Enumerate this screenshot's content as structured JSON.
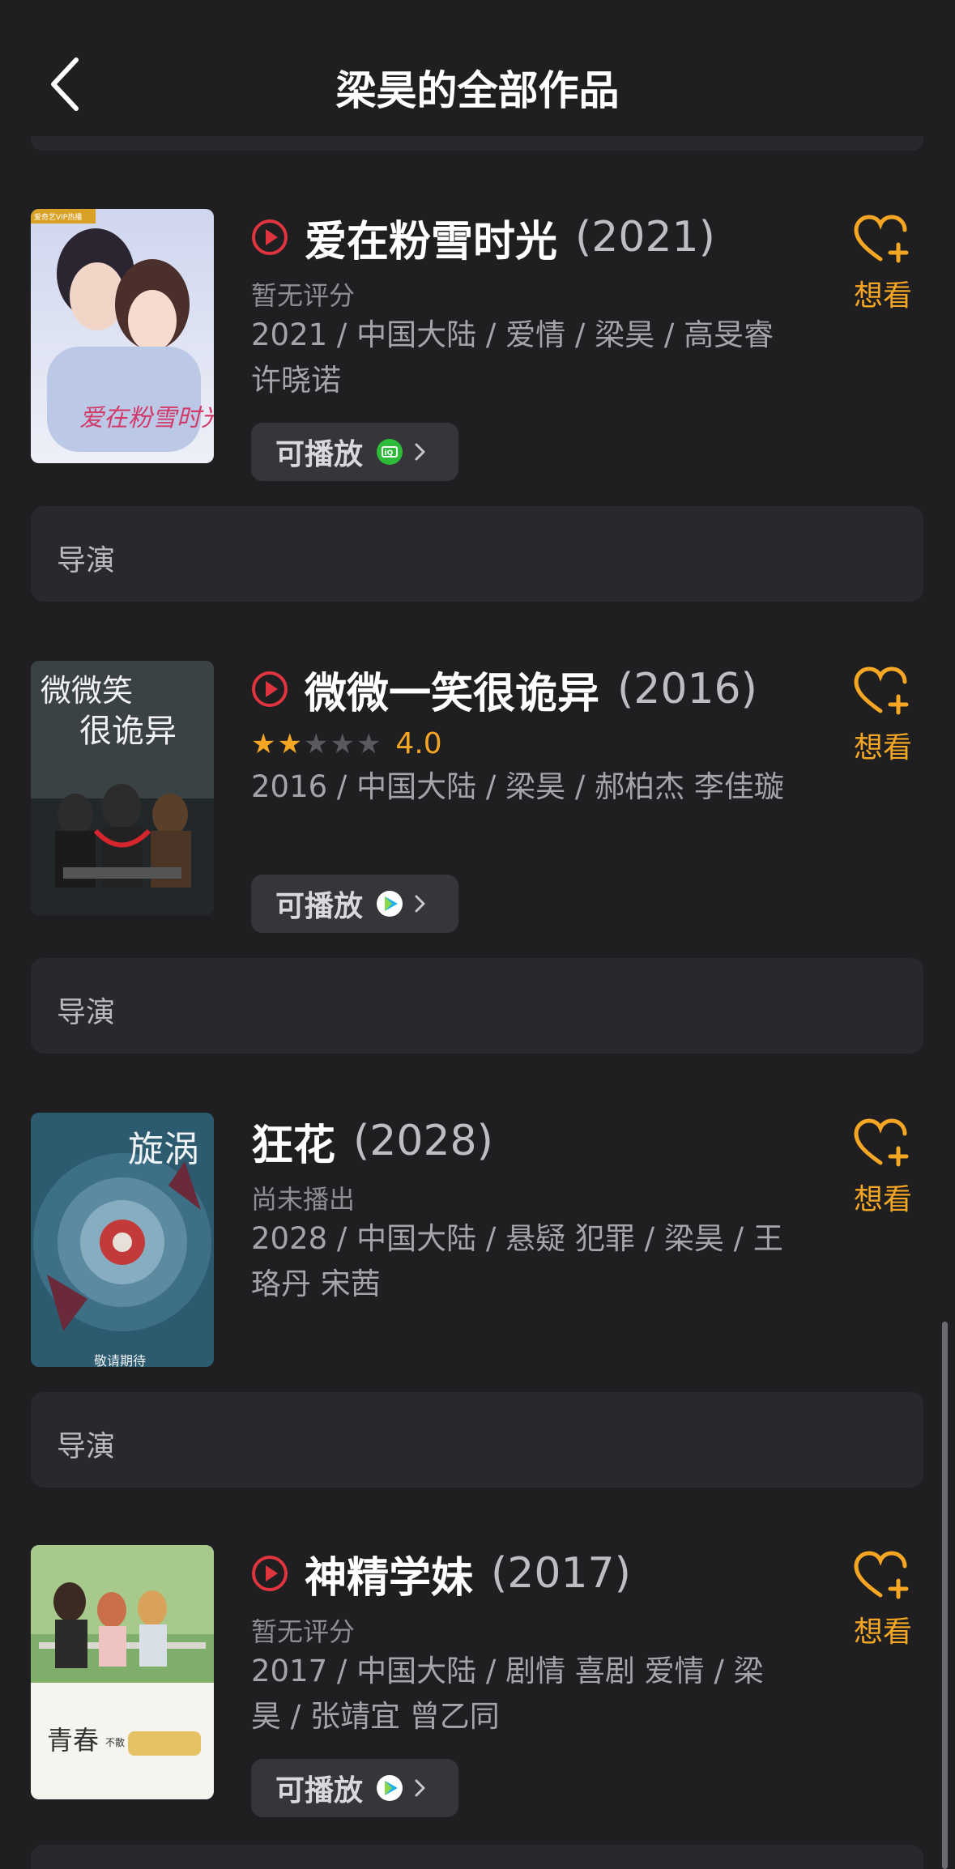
{
  "header": {
    "title": "梁昊的全部作品"
  },
  "colors": {
    "accent": "#f5a623",
    "play_red": "#e0343f",
    "background": "#1f1f22"
  },
  "movies": [
    {
      "title": "爱在粉雪时光",
      "year": "(2021)",
      "rating_text": "暂无评分",
      "meta": "2021 / 中国大陆 / 爱情 / 梁昊 / 高旻睿 许晓诺",
      "play_label": "可播放",
      "platform_icon": "iqiyi-icon",
      "want_label": "想看",
      "poster": {
        "badge": "爱奇艺VIP热播",
        "title": "爱在粉雪时光"
      }
    },
    {
      "title": "微微一笑很诡异",
      "year": "(2016)",
      "rating_score": "4.0",
      "stars_filled": 2,
      "stars_total": 5,
      "meta": "2016 / 中国大陆 / 梁昊 / 郝柏杰 李佳璇",
      "play_label": "可播放",
      "platform_icon": "tencent-video-icon",
      "want_label": "想看",
      "poster": {
        "title_line1": "微微笑",
        "title_line2": "很诡异"
      }
    },
    {
      "title": "狂花",
      "year": "(2028)",
      "rating_text": "尚未播出",
      "meta": "2028 / 中国大陆 / 悬疑 犯罪 / 梁昊 / 王珞丹 宋茜",
      "want_label": "想看",
      "poster": {
        "caption": "敬请期待",
        "glyph": "旋涡"
      }
    },
    {
      "title": "神精学妹",
      "year": "(2017)",
      "rating_text": "暂无评分",
      "meta": "2017 / 中国大陆 / 剧情 喜剧 爱情 / 梁昊 / 张靖宜 曾乙同",
      "play_label": "可播放",
      "platform_icon": "tencent-video-icon",
      "want_label": "想看",
      "poster": {
        "text_left": "青春",
        "text_small": "不散"
      }
    }
  ],
  "sections": [
    {
      "label": "导演"
    },
    {
      "label": "导演"
    },
    {
      "label": "导演"
    }
  ]
}
